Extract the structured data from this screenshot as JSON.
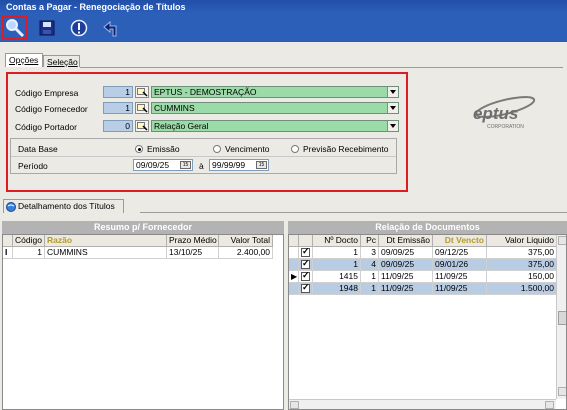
{
  "window": {
    "title": "Contas a Pagar - Renegociação de Títulos"
  },
  "toolbar": {
    "buttons": [
      {
        "icon": "search-icon",
        "active": true
      },
      {
        "icon": "save-icon"
      },
      {
        "icon": "info-icon"
      },
      {
        "icon": "back-arrow-icon"
      }
    ]
  },
  "tabs": {
    "opcoes": "Opções",
    "selecao": "Seleção"
  },
  "form": {
    "empresa_label": "Código Empresa",
    "empresa_code": "1",
    "empresa_name": "EPTUS - DEMOSTRAÇÃO",
    "fornecedor_label": "Código Fornecedor",
    "fornecedor_code": "1",
    "fornecedor_name": "CUMMINS",
    "portador_label": "Código Portador",
    "portador_code": "0",
    "portador_name": "Relação Geral",
    "database_label": "Data Base",
    "radio_emissao": "Emissão",
    "radio_vencimento": "Vencimento",
    "radio_previsao": "Previsão Recebimento",
    "radio_selected": "Emissão",
    "periodo_label": "Período",
    "periodo_from": "09/09/25",
    "periodo_sep": "à",
    "periodo_to": "99/99/99"
  },
  "logo": {
    "name": "eptus",
    "subtitle": "CORPORATION"
  },
  "detail_tab": {
    "label": "Detalhamento dos Títulos"
  },
  "resumo": {
    "title": "Resumo p/ Fornecedor",
    "columns": [
      "Código",
      "Razão",
      "Prazo Médio",
      "Valor Total"
    ],
    "rows": [
      {
        "codigo": "1",
        "razao": "CUMMINS",
        "prazo": "13/10/25",
        "valor": "2.400,00"
      }
    ]
  },
  "relacao": {
    "title": "Relação de Documentos",
    "columns": [
      "Nº Docto",
      "Pc",
      "Dt Emissão",
      "Dt Vencto",
      "Valor Liquido"
    ],
    "rows": [
      {
        "checked": true,
        "docto": "1",
        "pc": "3",
        "emissao": "09/09/25",
        "vencto": "09/12/25",
        "valor": "375,00",
        "selected": false
      },
      {
        "checked": true,
        "docto": "1",
        "pc": "4",
        "emissao": "09/09/25",
        "vencto": "09/01/26",
        "valor": "375,00",
        "selected": true
      },
      {
        "checked": true,
        "docto": "1415",
        "pc": "1",
        "emissao": "11/09/25",
        "vencto": "11/09/25",
        "valor": "150,00",
        "selected": false
      },
      {
        "checked": true,
        "docto": "1948",
        "pc": "1",
        "emissao": "11/09/25",
        "vencto": "11/09/25",
        "valor": "1.500,00",
        "selected": true
      }
    ]
  },
  "colors": {
    "titlebar": "#1f4fa8",
    "toolbar": "#2c5fb8",
    "highlight": "#e01b22",
    "combo": "#9bdba8",
    "numfield": "#b9cde6",
    "selected_row": "#b8cde4",
    "header_text_accent": "#b59a2a"
  }
}
